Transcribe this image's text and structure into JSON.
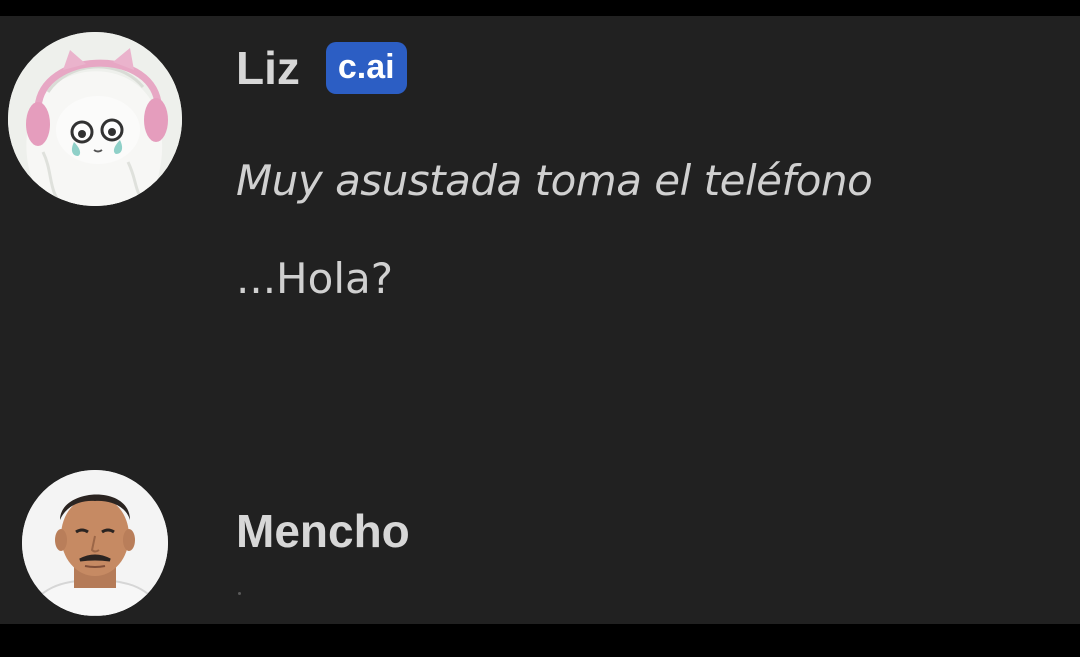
{
  "messages": [
    {
      "author": "Liz",
      "badge": "c.ai",
      "avatar_icon": "anime-girl-headphones-avatar",
      "lines": [
        "Muy asustada toma el teléfono",
        "...Hola?"
      ]
    },
    {
      "author": "Mencho",
      "avatar_icon": "man-mustache-avatar"
    }
  ],
  "colors": {
    "background": "#212121",
    "frame": "#000000",
    "name_text": "#d7d7d7",
    "body_text": "#d0d0d0",
    "badge_bg": "#2c5ec4"
  }
}
